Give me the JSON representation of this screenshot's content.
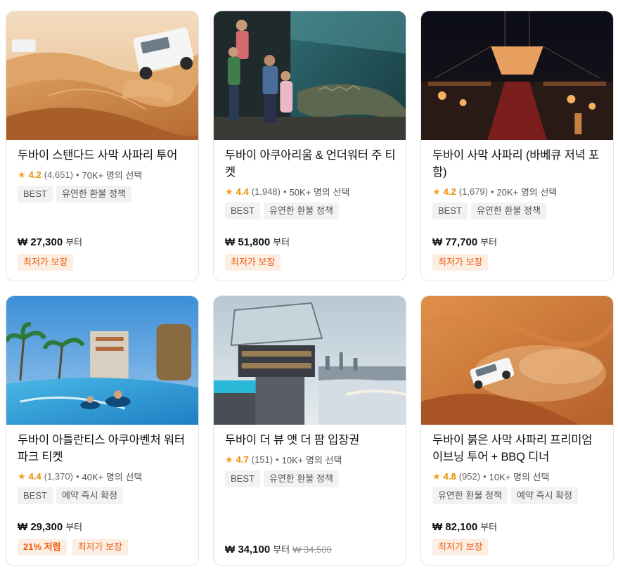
{
  "cards": [
    {
      "title": "두바이 스탠다드 사막 사파리 투어",
      "score": "4.2",
      "count": "(4,651)",
      "dot": "•",
      "picks": "70K+ 명의 선택",
      "tags": [
        "BEST",
        "유연한 환불 정책"
      ],
      "price": "₩ 27,300",
      "price_unit": "부터",
      "old_price": "",
      "badges": [
        "최저가 보장"
      ]
    },
    {
      "title": "두바이 아쿠아리움 & 언더워터 주 티켓",
      "score": "4.4",
      "count": "(1,948)",
      "dot": "•",
      "picks": "50K+ 명의 선택",
      "tags": [
        "BEST",
        "유연한 환불 정책"
      ],
      "price": "₩ 51,800",
      "price_unit": "부터",
      "old_price": "",
      "badges": [
        "최저가 보장"
      ]
    },
    {
      "title": "두바이 사막 사파리 (바베큐 저녁 포함)",
      "score": "4.2",
      "count": "(1,679)",
      "dot": "•",
      "picks": "20K+ 명의 선택",
      "tags": [
        "BEST",
        "유연한 환불 정책"
      ],
      "price": "₩ 77,700",
      "price_unit": "부터",
      "old_price": "",
      "badges": [
        "최저가 보장"
      ]
    },
    {
      "title": "두바이 아틀란티스 아쿠아벤처 워터파크 티켓",
      "score": "4.4",
      "count": "(1,370)",
      "dot": "•",
      "picks": "40K+ 명의 선택",
      "tags": [
        "BEST",
        "예약 즉시 확정"
      ],
      "price": "₩ 29,300",
      "price_unit": "부터",
      "old_price": "",
      "badges": [
        "21% 저렴",
        "최저가 보장"
      ]
    },
    {
      "title": "두바이 더 뷰 앳 더 팜 입장권",
      "score": "4.7",
      "count": "(151)",
      "dot": "•",
      "picks": "10K+ 명의 선택",
      "tags": [
        "BEST",
        "유연한 환불 정책"
      ],
      "price": "₩ 34,100",
      "price_unit": "부터",
      "old_price": "₩ 34,500",
      "badges": []
    },
    {
      "title": "두바이 붉은 사막 사파리 프리미엄 이브닝 투어 + BBQ 디너",
      "score": "4.8",
      "count": "(952)",
      "dot": "•",
      "picks": "10K+ 명의 선택",
      "tags": [
        "유연한 환불 정책",
        "예약 즉시 확정"
      ],
      "price": "₩ 82,100",
      "price_unit": "부터",
      "old_price": "",
      "badges": [
        "최저가 보장"
      ]
    }
  ],
  "icons": {
    "star": "star-icon"
  },
  "colors": {
    "accent_orange": "#ec5b10",
    "star": "#f4a01e",
    "badge_bg": "#fdeee4"
  }
}
